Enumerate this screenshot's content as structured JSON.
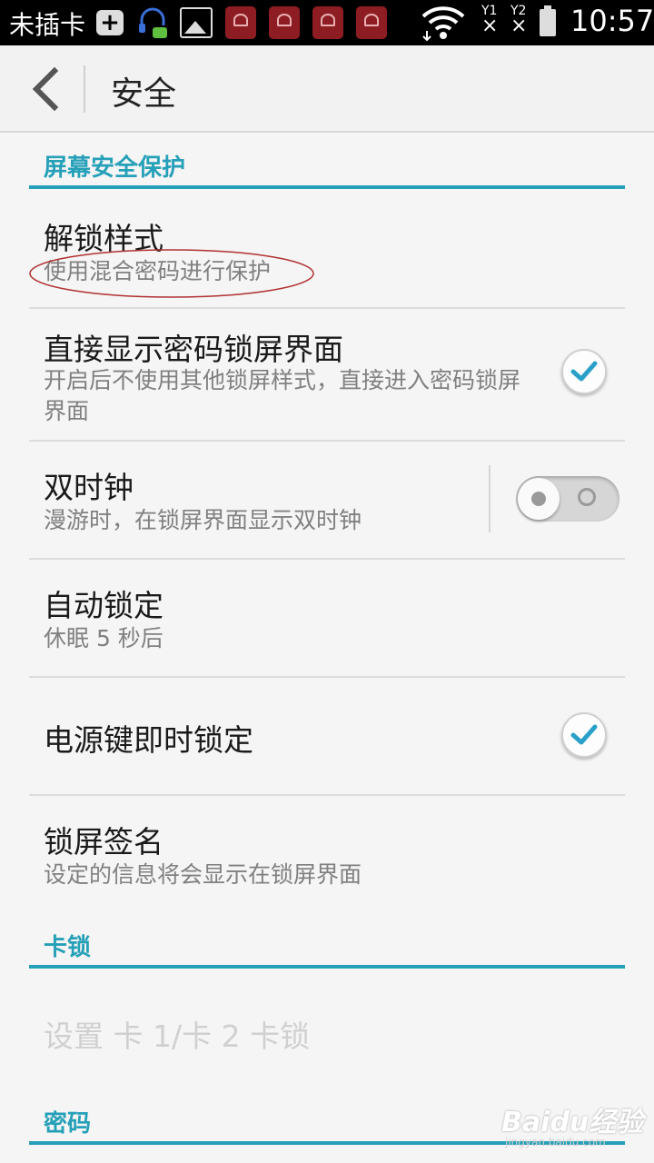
{
  "status_bar": {
    "carrier": "未插卡",
    "sim1_label": "Y1",
    "sim2_label": "Y2",
    "time": "10:57",
    "icons": [
      "plus-icon",
      "headset-icon",
      "gallery-icon",
      "huawei-app-icon",
      "wifi-icon",
      "signal-icon",
      "battery-icon"
    ]
  },
  "action_bar": {
    "title": "安全",
    "back_icon": "back-chevron-icon"
  },
  "sections": {
    "screen": "屏幕安全保护",
    "sim": "卡锁",
    "password": "密码"
  },
  "items": {
    "unlock_style": {
      "title": "解锁样式",
      "summary": "使用混合密码进行保护"
    },
    "direct_password": {
      "title": "直接显示密码锁屏界面",
      "summary": "开启后不使用其他锁屏样式，直接进入密码锁屏界面",
      "checked": true
    },
    "dual_clock": {
      "title": "双时钟",
      "summary": "漫游时，在锁屏界面显示双时钟",
      "enabled": false
    },
    "auto_lock": {
      "title": "自动锁定",
      "summary": "休眠 5 秒后"
    },
    "power_lock": {
      "title": "电源键即时锁定",
      "checked": true
    },
    "lock_signature": {
      "title": "锁屏签名",
      "summary": "设定的信息将会显示在锁屏界面"
    },
    "sim_lock": {
      "title": "设置 卡 1/卡 2 卡锁"
    }
  },
  "watermark": {
    "brand": "Baidu经验",
    "url": "jingyan.baidu.com"
  },
  "colors": {
    "accent": "#26a0b8",
    "status_bar": "#000000",
    "background": "#f5f5f5",
    "annotation": "#b03030"
  }
}
